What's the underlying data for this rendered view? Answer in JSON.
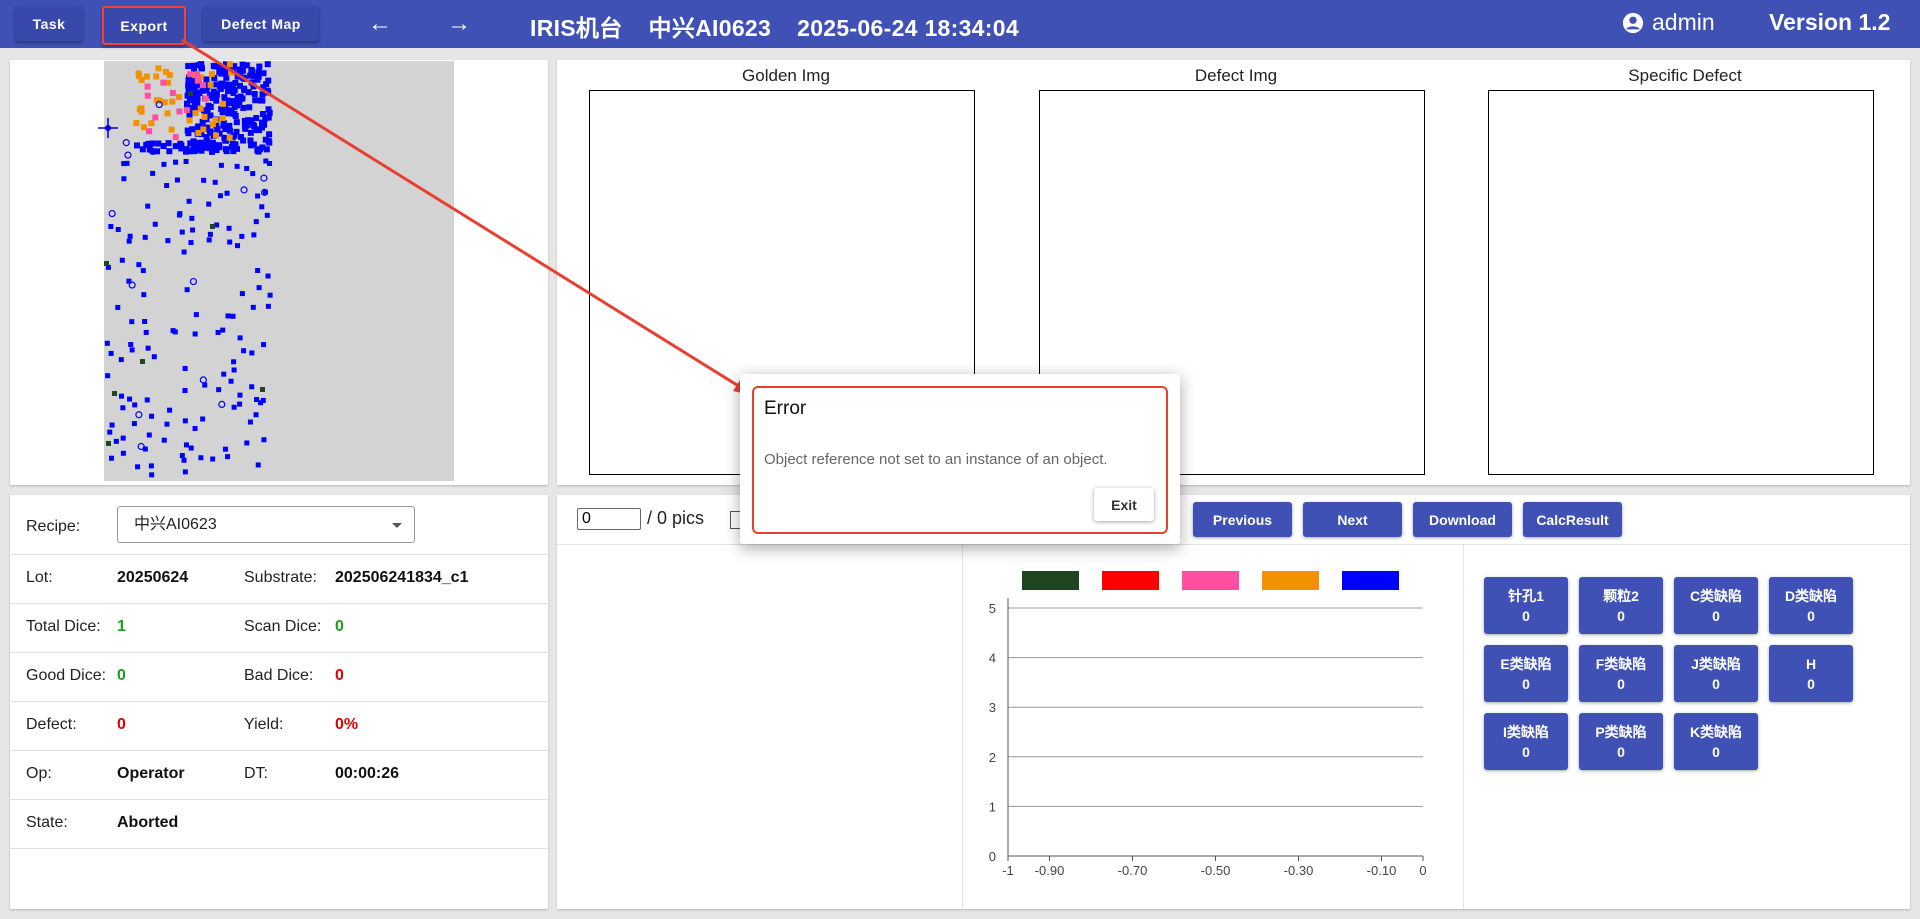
{
  "toolbar": {
    "task_label": "Task",
    "export_label": "Export",
    "defect_map_label": "Defect Map",
    "back_arrow": "←",
    "forward_arrow": "→"
  },
  "header": {
    "machine": "IRIS机台",
    "recipe": "中兴AI0623",
    "datetime": "2025-06-24 18:34:04",
    "user": "admin",
    "version": "Version 1.2"
  },
  "viewers": {
    "golden_title": "Golden Img",
    "defect_title": "Defect Img",
    "specific_title": "Specific Defect"
  },
  "info": {
    "recipe_label": "Recipe:",
    "recipe_value": "中兴AI0623",
    "lot_label": "Lot:",
    "lot_value": "20250624",
    "substrate_label": "Substrate:",
    "substrate_value": "202506241834_c1",
    "total_dice_label": "Total Dice:",
    "total_dice_value": "1",
    "scan_dice_label": "Scan Dice:",
    "scan_dice_value": "0",
    "good_dice_label": "Good Dice:",
    "good_dice_value": "0",
    "bad_dice_label": "Bad Dice:",
    "bad_dice_value": "0",
    "defect_label": "Defect:",
    "defect_value": "0",
    "yield_label": "Yield:",
    "yield_value": "0%",
    "op_label": "Op:",
    "op_value": "Operator",
    "dt_label": "DT:",
    "dt_value": "00:00:26",
    "state_label": "State:",
    "state_value": "Aborted"
  },
  "results": {
    "pic_index": "0",
    "pic_count": "/ 0 pics",
    "previous_label": "Previous",
    "next_label": "Next",
    "download_label": "Download",
    "calc_label": "CalcResult"
  },
  "chart_data": {
    "type": "line",
    "legend_colors": [
      "#1e4620",
      "#ff0000",
      "#ff4fa0",
      "#f39200",
      "#0000ff"
    ],
    "x_ticks": [
      "-1",
      "-0.90",
      "-0.70",
      "-0.50",
      "-0.30",
      "-0.10",
      "0"
    ],
    "x_values": [
      -1,
      -0.9,
      -0.7,
      -0.5,
      -0.3,
      -0.1,
      0
    ],
    "y_ticks": [
      "0",
      "1",
      "2",
      "3",
      "4",
      "5"
    ],
    "ylim": [
      0,
      5
    ],
    "xlim": [
      -1,
      0
    ],
    "grid": true,
    "legend_position": "top"
  },
  "defect_types": [
    {
      "name": "针孔1",
      "count": "0"
    },
    {
      "name": "颗粒2",
      "count": "0"
    },
    {
      "name": "C类缺陷",
      "count": "0"
    },
    {
      "name": "D类缺陷",
      "count": "0"
    },
    {
      "name": "E类缺陷",
      "count": "0"
    },
    {
      "name": "F类缺陷",
      "count": "0"
    },
    {
      "name": "J类缺陷",
      "count": "0"
    },
    {
      "name": "H",
      "count": "0"
    },
    {
      "name": "I类缺陷",
      "count": "0"
    },
    {
      "name": "P类缺陷",
      "count": "0"
    },
    {
      "name": "K类缺陷",
      "count": "0"
    }
  ],
  "dialog": {
    "title": "Error",
    "message": "Object reference not set to an instance of an object.",
    "exit_label": "Exit"
  },
  "colors": {
    "primary": "#3f51b5",
    "good": "#1e9e1e",
    "bad": "#e00000",
    "annotation": "#e84030",
    "defect_blue": "#0000ff",
    "defect_orange": "#f39200",
    "defect_pink": "#ff4fa0",
    "defect_green": "#1e4620"
  }
}
